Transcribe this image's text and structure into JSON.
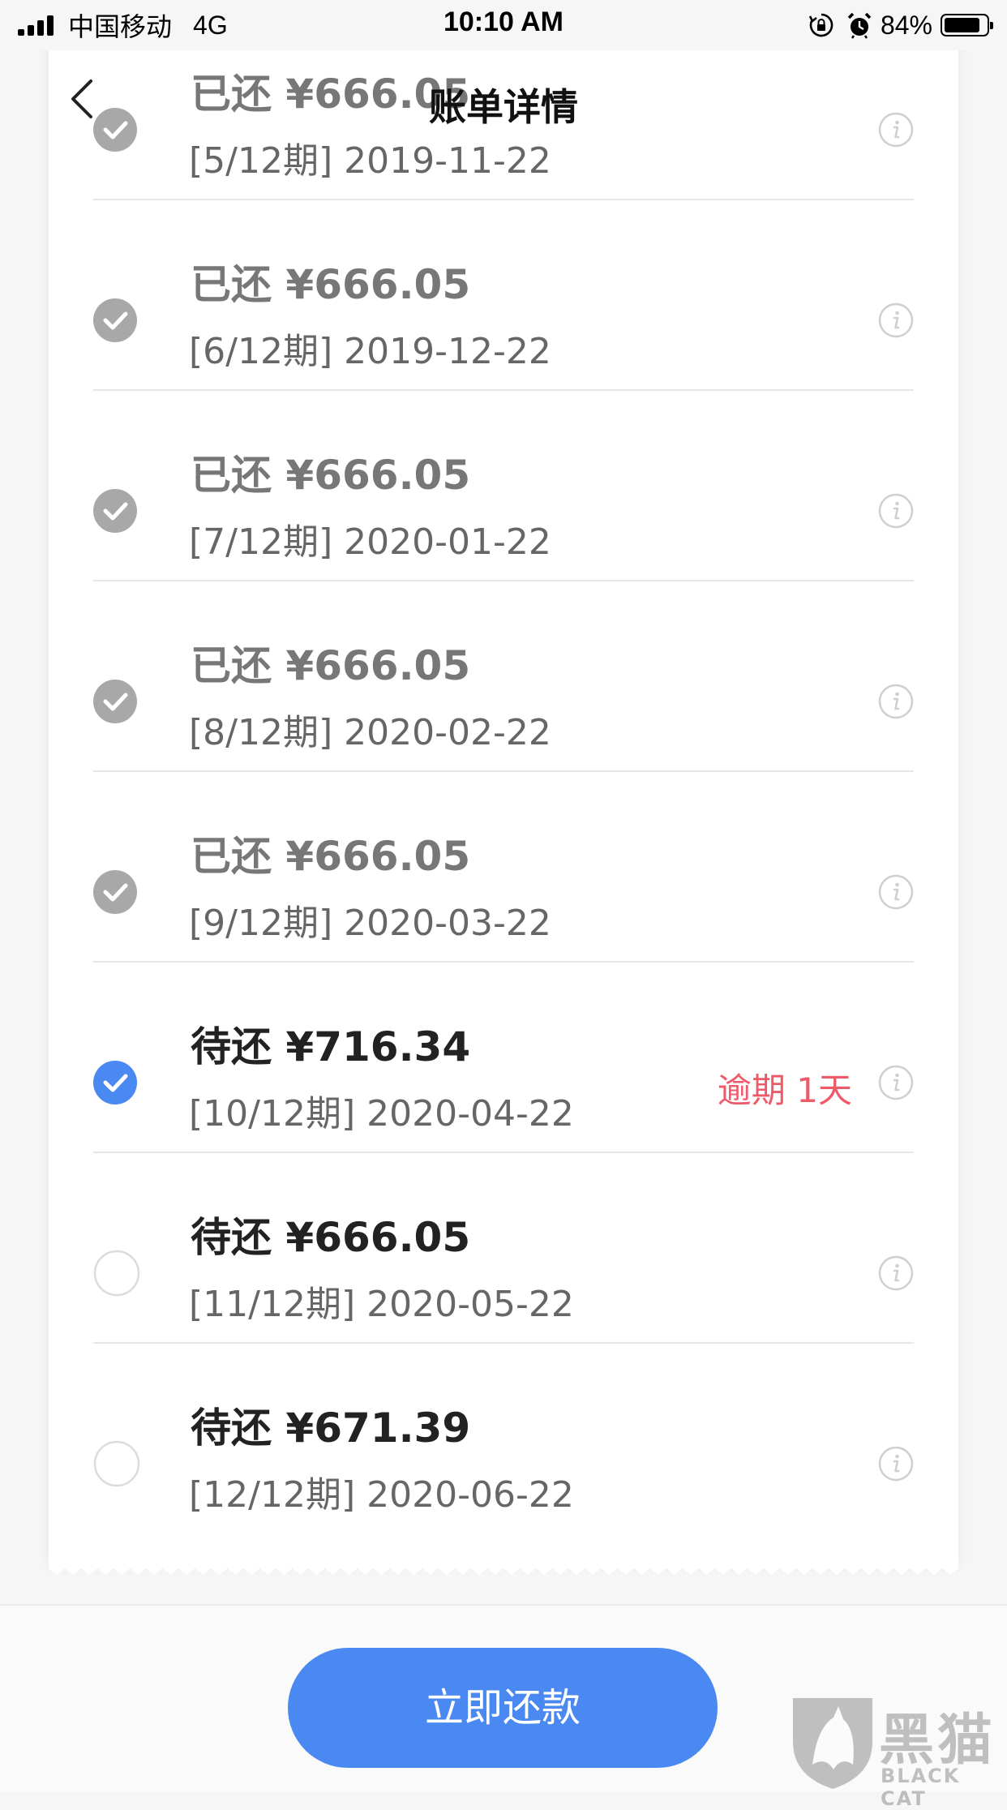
{
  "status_bar": {
    "carrier": "中国移动",
    "network": "4G",
    "time": "10:10 AM",
    "battery": "84%",
    "battery_level": 0.84
  },
  "nav": {
    "title": "账单详情",
    "back_icon": "chevron-left-icon"
  },
  "installments": [
    {
      "amount": "已还 ¥666.05",
      "period": "[5/12期] 2019-11-22",
      "status": "paid",
      "overdue": ""
    },
    {
      "amount": "已还 ¥666.05",
      "period": "[6/12期] 2019-12-22",
      "status": "paid",
      "overdue": ""
    },
    {
      "amount": "已还 ¥666.05",
      "period": "[7/12期] 2020-01-22",
      "status": "paid",
      "overdue": ""
    },
    {
      "amount": "已还 ¥666.05",
      "period": "[8/12期] 2020-02-22",
      "status": "paid",
      "overdue": ""
    },
    {
      "amount": "已还 ¥666.05",
      "period": "[9/12期] 2020-03-22",
      "status": "paid",
      "overdue": ""
    },
    {
      "amount": "待还 ¥716.34",
      "period": "[10/12期] 2020-04-22",
      "status": "selected",
      "overdue": "逾期 1天"
    },
    {
      "amount": "待还 ¥666.05",
      "period": "[11/12期] 2020-05-22",
      "status": "unselected",
      "overdue": ""
    },
    {
      "amount": "待还 ¥671.39",
      "period": "[12/12期] 2020-06-22",
      "status": "unselected",
      "overdue": ""
    }
  ],
  "footer": {
    "pay_button": "立即还款"
  },
  "watermark": {
    "name": "黑猫",
    "sub": "BLACK CAT"
  },
  "colors": {
    "accent": "#4a88f2",
    "paid_check": "#a8a8a8",
    "overdue": "#ee5a6a",
    "paid_text": "#777777",
    "pending_text": "#222222"
  }
}
